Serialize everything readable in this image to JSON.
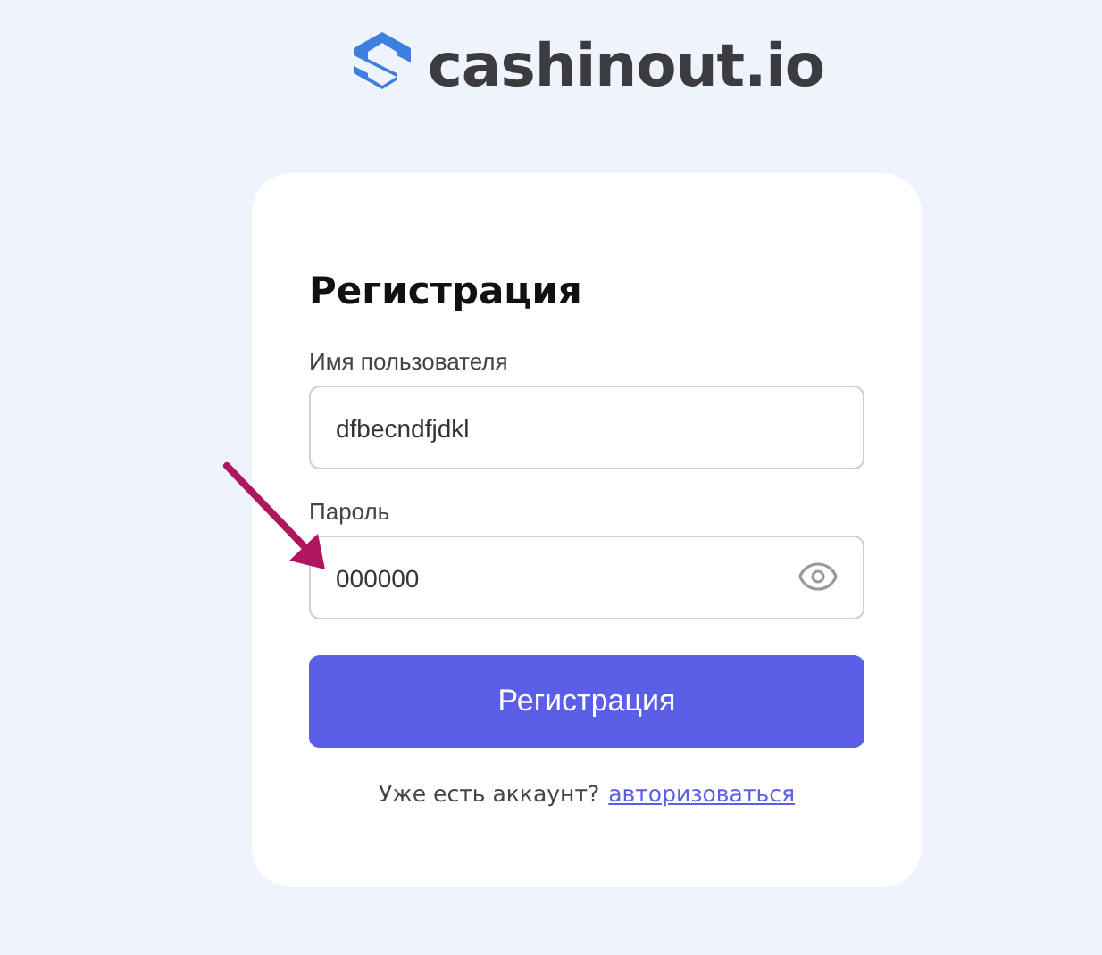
{
  "logo": {
    "text": "cashinout.io"
  },
  "form": {
    "title": "Регистрация",
    "fields": [
      {
        "label": "Имя пользователя",
        "value": "dfbecndfjdkl",
        "kind": "text"
      },
      {
        "label": "Пароль",
        "value": "000000",
        "kind": "password"
      }
    ],
    "submit": "Регистрация",
    "footer": {
      "text": "Уже есть аккаунт?",
      "link": "авторизоваться"
    }
  }
}
